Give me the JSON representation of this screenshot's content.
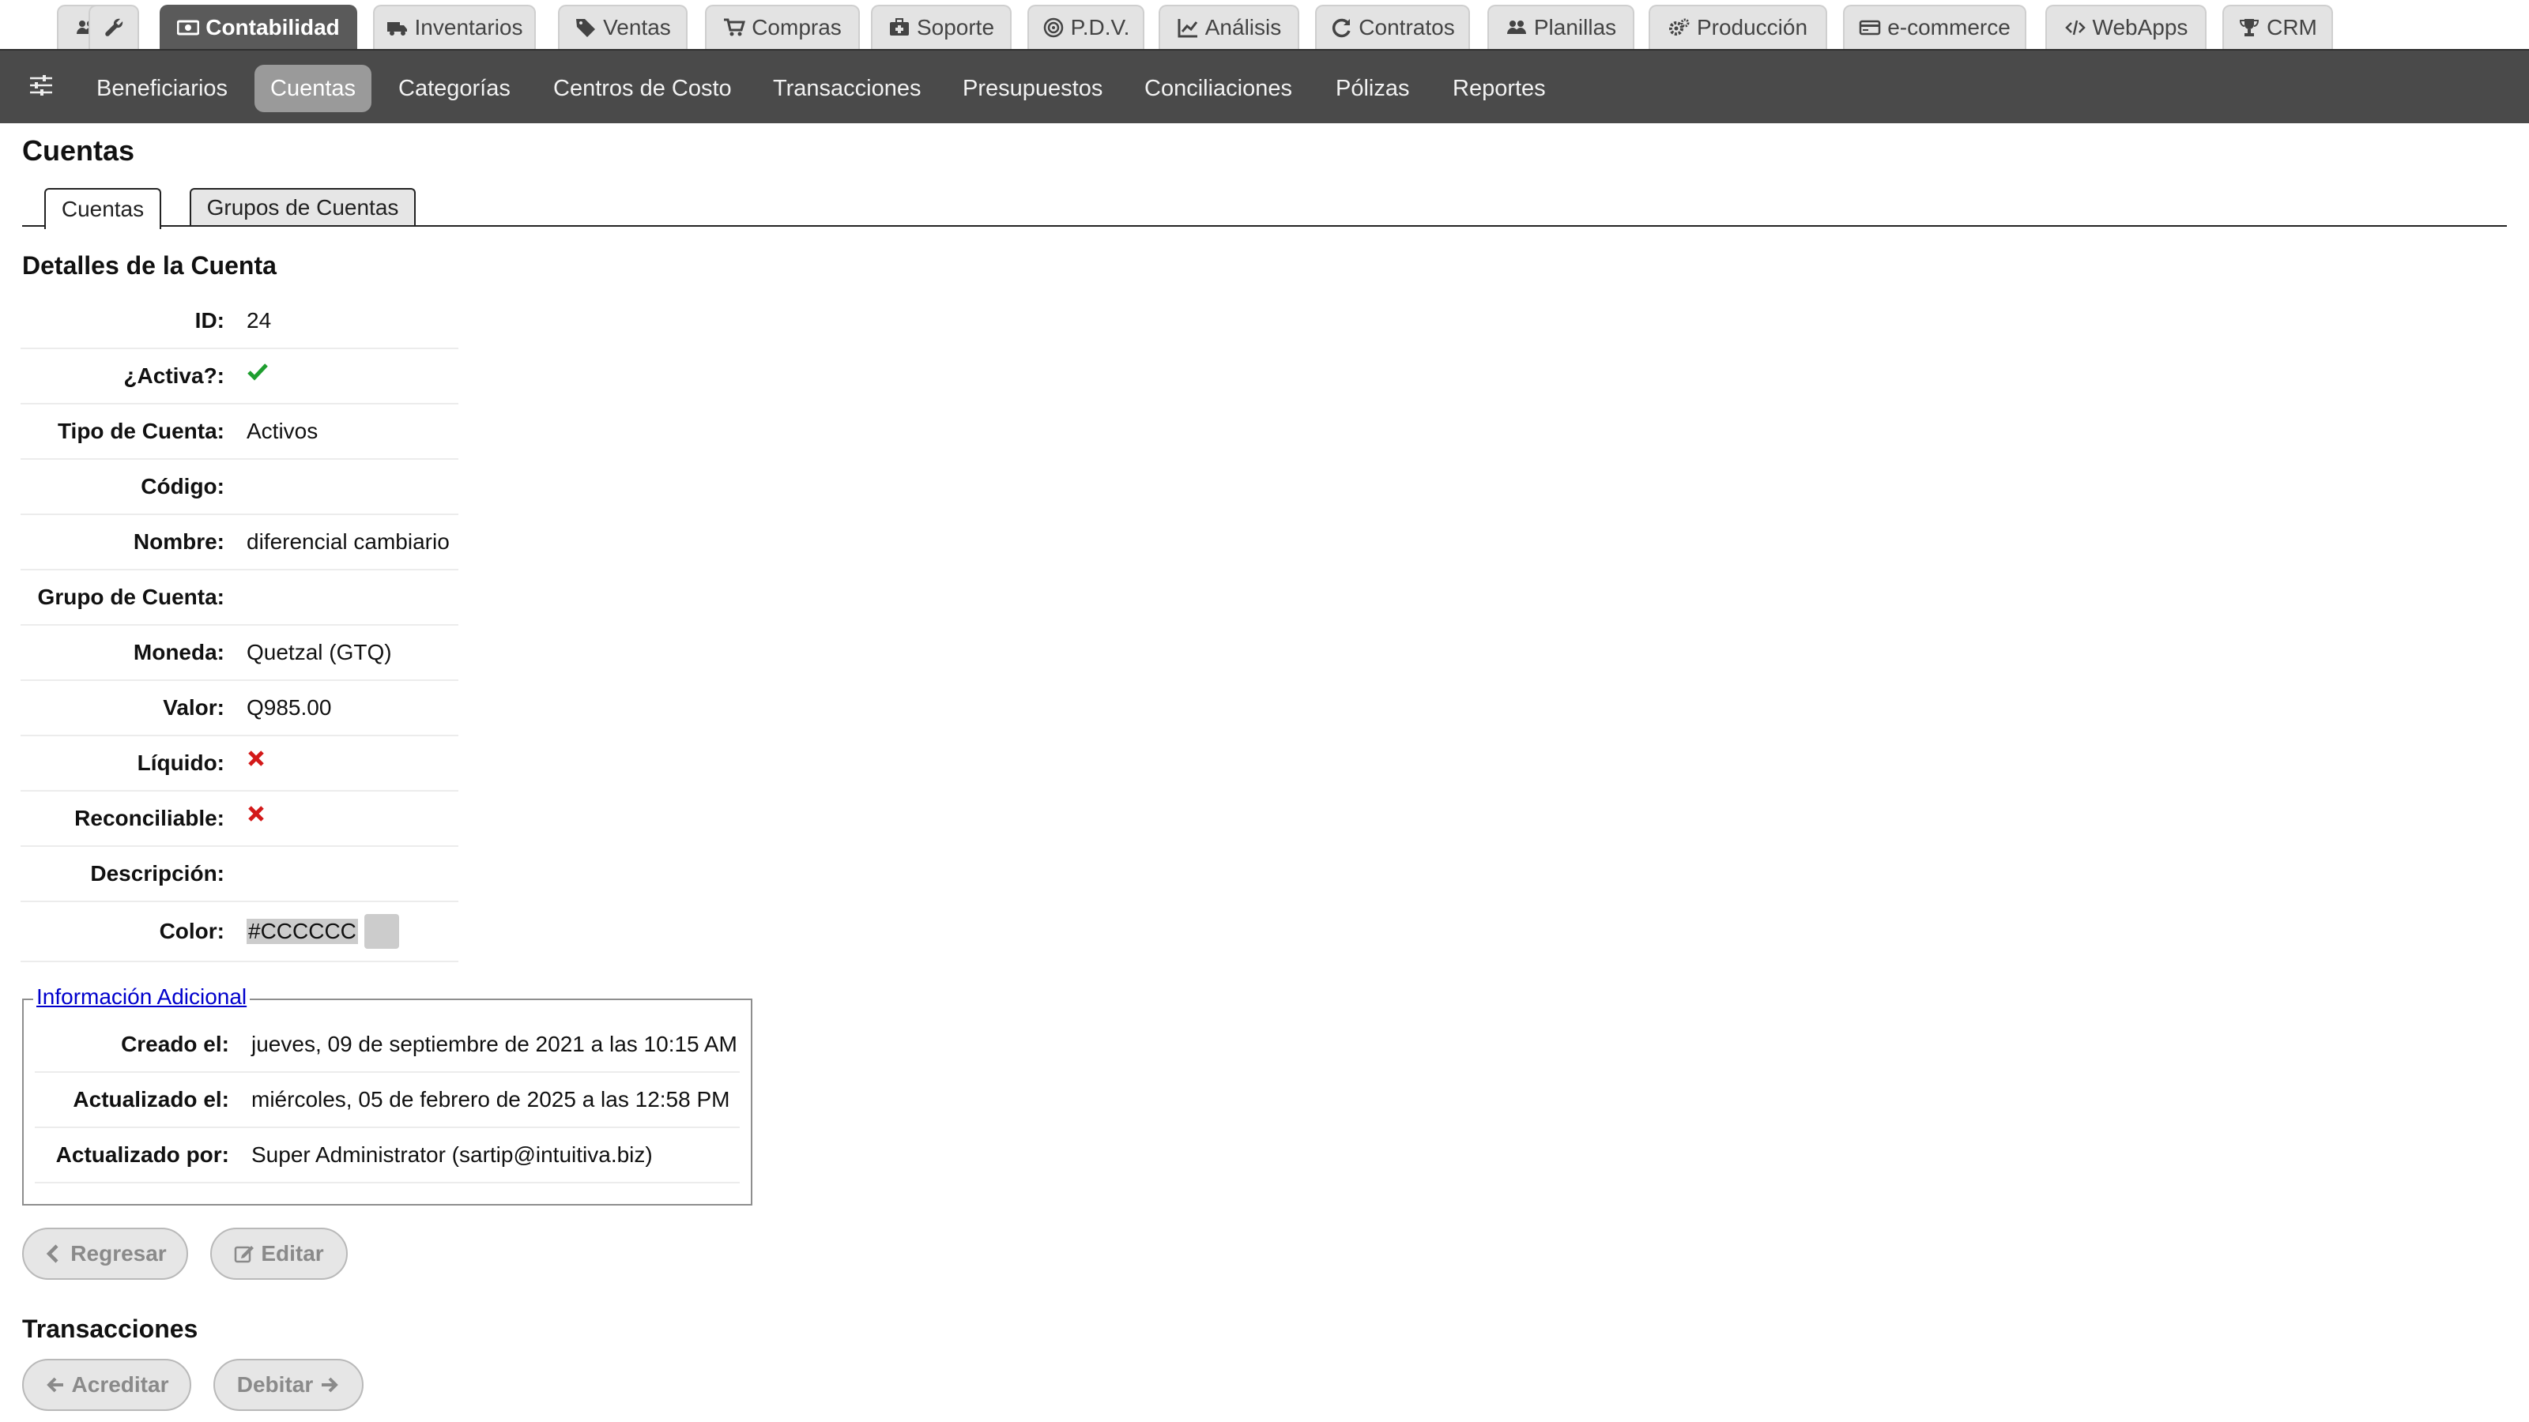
{
  "top_tabs": [
    {
      "label": "",
      "icon": "users-icon"
    },
    {
      "label": "",
      "icon": "wrench-icon"
    },
    {
      "label": "Contabilidad",
      "icon": "money-icon"
    },
    {
      "label": "Inventarios",
      "icon": "truck-icon"
    },
    {
      "label": "Ventas",
      "icon": "tags-icon"
    },
    {
      "label": "Compras",
      "icon": "cart-icon"
    },
    {
      "label": "Soporte",
      "icon": "medkit-icon"
    },
    {
      "label": "P.D.V.",
      "icon": "target-icon"
    },
    {
      "label": "Análisis",
      "icon": "chart-line-icon"
    },
    {
      "label": "Contratos",
      "icon": "refresh-icon"
    },
    {
      "label": "Planillas",
      "icon": "users-icon"
    },
    {
      "label": "Producción",
      "icon": "cogs-icon"
    },
    {
      "label": "e-commerce",
      "icon": "credit-card-icon"
    },
    {
      "label": "WebApps",
      "icon": "code-icon"
    },
    {
      "label": "CRM",
      "icon": "trophy-icon"
    }
  ],
  "active_top_tab": "Contabilidad",
  "sub_nav": {
    "toggle_icon": "sliders-icon",
    "items": [
      "Beneficiarios",
      "Cuentas",
      "Categorías",
      "Centros de Costo",
      "Transacciones",
      "Presupuestos",
      "Conciliaciones",
      "Pólizas",
      "Reportes"
    ],
    "active": "Cuentas"
  },
  "page_title": "Cuentas",
  "content_tabs": [
    "Cuentas",
    "Grupos de Cuentas"
  ],
  "section_title": "Detalles de la Cuenta",
  "details": [
    {
      "label": "ID:",
      "value": "24"
    },
    {
      "label": "¿Activa?:",
      "value": "",
      "icon": "check-icon"
    },
    {
      "label": "Tipo de Cuenta:",
      "value": "Activos"
    },
    {
      "label": "Código:",
      "value": ""
    },
    {
      "label": "Nombre:",
      "value": "diferencial cambiario"
    },
    {
      "label": "Grupo de Cuenta:",
      "value": ""
    },
    {
      "label": "Moneda:",
      "value": "Quetzal (GTQ)"
    },
    {
      "label": "Valor:",
      "value": "Q985.00"
    },
    {
      "label": "Líquido:",
      "value": "",
      "icon": "cross-icon"
    },
    {
      "label": "Reconciliable:",
      "value": "",
      "icon": "cross-icon"
    },
    {
      "label": "Descripción:",
      "value": ""
    },
    {
      "label": "Color:",
      "value": "#CCCCCC"
    }
  ],
  "colors": {
    "account_color": "#CCCCCC",
    "check": "#1e9e2f",
    "cross": "#d31919",
    "active_tab": "#5a5a5a",
    "subnav": "#4a4a4a",
    "link": "#0000cc"
  },
  "additional_info": {
    "legend": "Información Adicional",
    "rows": [
      {
        "label": "Creado el:",
        "value": "jueves, 09 de septiembre de 2021 a las 10:15 AM"
      },
      {
        "label": "Actualizado el:",
        "value": "miércoles, 05 de febrero de 2025 a las 12:58 PM"
      },
      {
        "label": "Actualizado por:",
        "value": "Super Administrator (sartip@intuitiva.biz)"
      }
    ]
  },
  "buttons": {
    "back": "Regresar",
    "edit": "Editar",
    "credit": "Acreditar",
    "debit": "Debitar"
  },
  "transactions_title": "Transacciones"
}
